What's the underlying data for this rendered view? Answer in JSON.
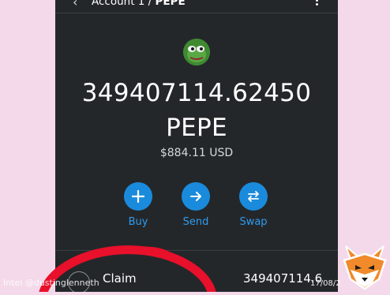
{
  "header": {
    "account_name": "Account 1 / ",
    "token_symbol": "PEPE",
    "back_icon": "chevron-left-icon",
    "menu_icon": "kebab-menu-icon"
  },
  "token": {
    "logo_icon": "pepe-frog-icon",
    "balance": "349407114.62450",
    "symbol": "PEPE",
    "fiat_value": "$884.11 USD"
  },
  "actions": [
    {
      "label": "Buy",
      "icon": "plus-icon"
    },
    {
      "label": "Send",
      "icon": "arrow-right-icon"
    },
    {
      "label": "Swap",
      "icon": "swap-arrows-icon"
    }
  ],
  "activity": {
    "claim_label": "Claim",
    "claim_amount": "349407114.6"
  },
  "overlay": {
    "watermark": "Intel @dustinglenneth",
    "date": "17/08/2",
    "annotation_color": "#e8102a"
  },
  "colors": {
    "accent": "#1a8bdc",
    "background": "#24272a"
  }
}
